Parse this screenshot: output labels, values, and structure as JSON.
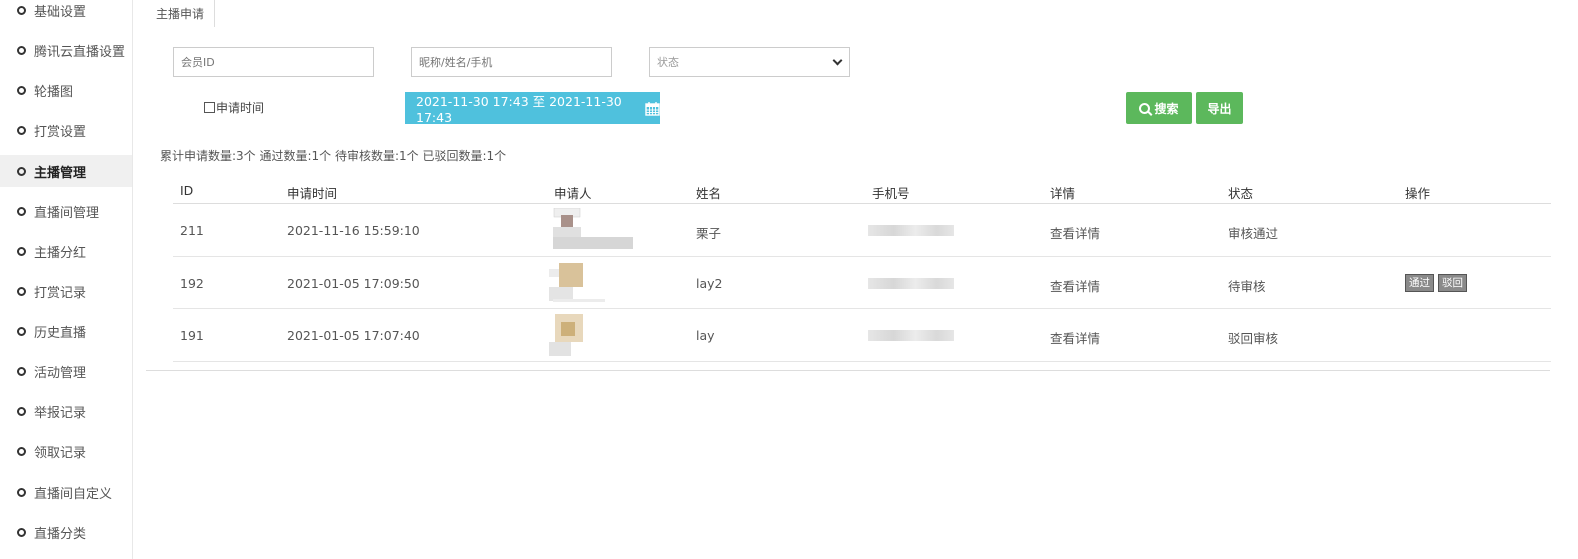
{
  "sidebar": {
    "items": [
      {
        "label": "基础设置",
        "active": false
      },
      {
        "label": "腾讯云直播设置",
        "active": false
      },
      {
        "label": "轮播图",
        "active": false
      },
      {
        "label": "打赏设置",
        "active": false
      },
      {
        "label": "主播管理",
        "active": true
      },
      {
        "label": "直播间管理",
        "active": false
      },
      {
        "label": "主播分红",
        "active": false
      },
      {
        "label": "打赏记录",
        "active": false
      },
      {
        "label": "历史直播",
        "active": false
      },
      {
        "label": "活动管理",
        "active": false
      },
      {
        "label": "举报记录",
        "active": false
      },
      {
        "label": "领取记录",
        "active": false
      },
      {
        "label": "直播间自定义",
        "active": false
      },
      {
        "label": "直播分类",
        "active": false
      }
    ]
  },
  "tab": {
    "label": "主播申请"
  },
  "filters": {
    "member_id_placeholder": "会员ID",
    "name_placeholder": "昵称/姓名/手机",
    "status_value": "状态",
    "apply_time_label": "申请时间",
    "date_range": "2021-11-30 17:43 至 2021-11-30 17:43",
    "search_label": "搜索",
    "export_label": "导出"
  },
  "stats": "累计申请数量:3个 通过数量:1个 待审核数量:1个 已驳回数量:1个",
  "table": {
    "headers": [
      "ID",
      "申请时间",
      "申请人",
      "姓名",
      "手机号",
      "详情",
      "状态",
      "操作"
    ],
    "rows": [
      {
        "id": "211",
        "time": "2021-11-16 15:59:10",
        "name": "栗子",
        "detail": "查看详情",
        "status": "审核通过",
        "actions": []
      },
      {
        "id": "192",
        "time": "2021-01-05 17:09:50",
        "name": "lay2",
        "detail": "查看详情",
        "status": "待审核",
        "actions": [
          "通过",
          "驳回"
        ]
      },
      {
        "id": "191",
        "time": "2021-01-05 17:07:40",
        "name": "lay",
        "detail": "查看详情",
        "status": "驳回审核",
        "actions": []
      }
    ]
  },
  "colors": {
    "date_bg": "#4fc1dd",
    "green_btn": "#5cb85c",
    "action_btn": "#8a8a8a"
  }
}
